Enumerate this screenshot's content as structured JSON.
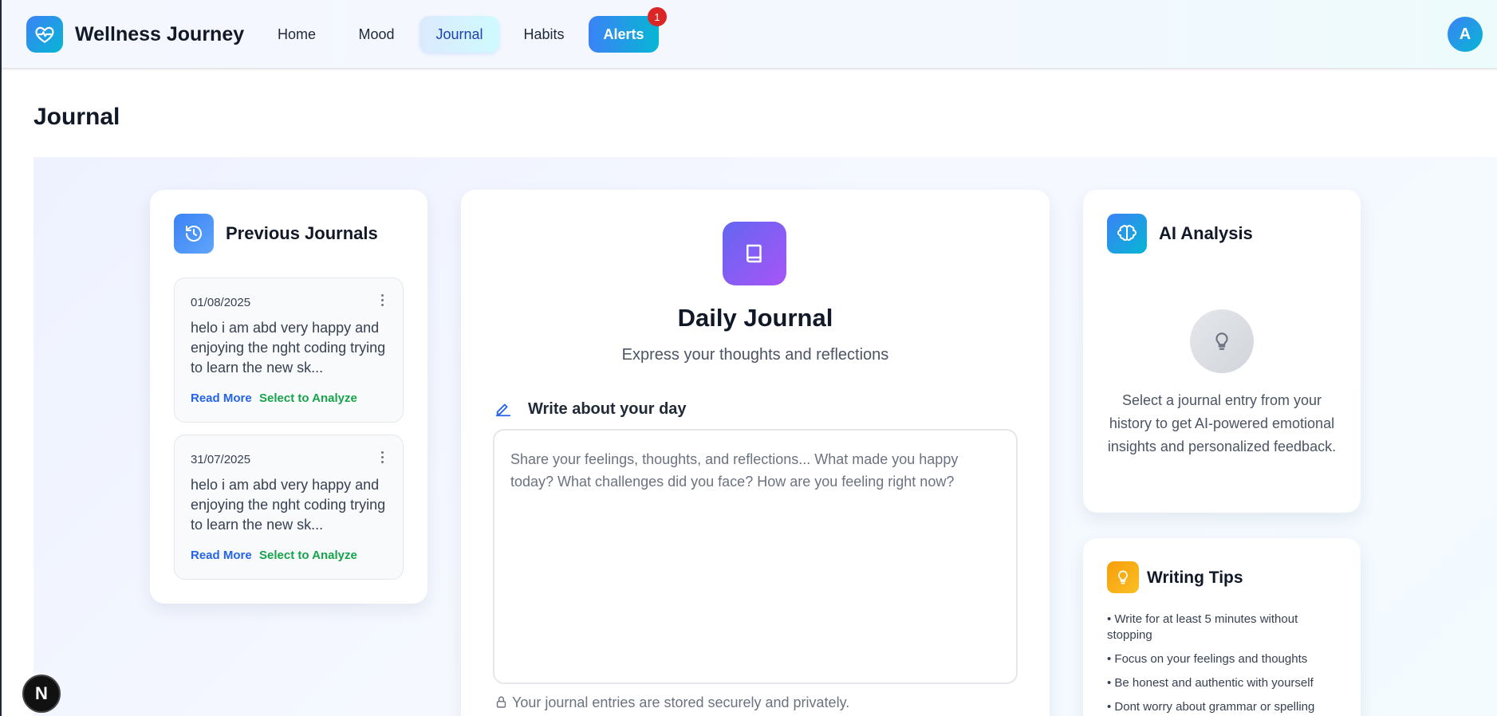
{
  "brand": "Wellness Journey",
  "nav": {
    "home": "Home",
    "mood": "Mood",
    "journal": "Journal",
    "habits": "Habits",
    "alerts": "Alerts",
    "alerts_badge": "1"
  },
  "user": {
    "avatar_initial": "A"
  },
  "page_title": "Journal",
  "previous": {
    "title": "Previous Journals",
    "entries": [
      {
        "date": "01/08/2025",
        "text": "helo i am abd very happy and enjoying the nght coding trying to learn the new sk...",
        "read_more": "Read More",
        "select": "Select to Analyze"
      },
      {
        "date": "31/07/2025",
        "text": "helo i am abd very happy and enjoying the nght coding trying to learn the new sk...",
        "read_more": "Read More",
        "select": "Select to Analyze"
      }
    ]
  },
  "daily": {
    "title": "Daily Journal",
    "subtitle": "Express your thoughts and reflections",
    "write_label": "Write about your day",
    "placeholder": "Share your feelings, thoughts, and reflections... What made you happy today? What challenges did you face? How are you feeling right now?",
    "secure_note": "Your journal entries are stored securely and privately."
  },
  "ai": {
    "title": "AI Analysis",
    "prompt": "Select a journal entry from your history to get AI-powered emotional insights and personalized feedback."
  },
  "tips": {
    "title": "Writing Tips",
    "items": [
      "• Write for at least 5 minutes without stopping",
      "• Focus on your feelings and thoughts",
      "• Be honest and authentic with yourself",
      "• Dont worry about grammar or spelling"
    ]
  },
  "dev_badge": "N",
  "colors": {
    "accent_blue": "#3b82f6",
    "accent_cyan": "#06b6d4",
    "accent_purple": "#a855f7",
    "link_blue": "#2563eb",
    "link_green": "#16a34a",
    "badge_red": "#dc2626",
    "tips_amber": "#f59e0b"
  }
}
